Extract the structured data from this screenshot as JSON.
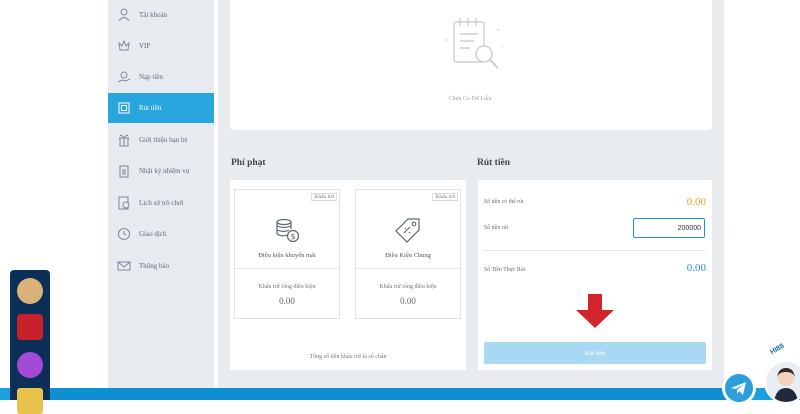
{
  "sidebar": {
    "items": [
      {
        "label": "Tài khoản",
        "icon": "user-icon"
      },
      {
        "label": "VIP",
        "icon": "vip-icon"
      },
      {
        "label": "Nạp tiền",
        "icon": "deposit-icon"
      },
      {
        "label": "Rút tiền",
        "icon": "withdraw-icon",
        "active": true
      },
      {
        "label": "Giới thiệu bạn bè",
        "icon": "gift-icon"
      },
      {
        "label": "Nhật ký nhiệm vụ",
        "icon": "clipboard-icon"
      },
      {
        "label": "Lịch sử trò chơi",
        "icon": "history-icon"
      },
      {
        "label": "Giao dịch",
        "icon": "transaction-icon"
      },
      {
        "label": "Thông báo",
        "icon": "mail-icon"
      }
    ]
  },
  "empty_state": {
    "text": "Chưa Có Dữ Liệu",
    "icon": "document-search-icon"
  },
  "penalty": {
    "title": "Phí phạt",
    "cards": [
      {
        "tag": "Khấu trừ",
        "name": "Điều kiện khuyến mãi",
        "sub": "Khấu trừ tổng điều kiện",
        "value": "0.00",
        "icon": "coins-icon"
      },
      {
        "tag": "Khấu trừ",
        "name": "Điều Kiện Chung",
        "sub": "Khấu trừ tổng điều kiện",
        "value": "0.00",
        "icon": "price-tag-icon"
      }
    ],
    "total_text": "Tổng số tiền khấu trừ là số chẵn"
  },
  "withdraw": {
    "title": "Rút tiền",
    "available_label": "Số tiền có thể rút",
    "available_value": "0.00",
    "amount_label": "Số tiền rút",
    "amount_value": "200000",
    "real_label": "Số Tiền Thực Rút",
    "real_value": "0.00",
    "button_label": "Rút tiền"
  },
  "brand_tag": "HI88",
  "colors": {
    "accent": "#2aa6df",
    "available": "#e8a21a",
    "real": "#2a8ad8",
    "button_disabled": "#a9d9f2",
    "arrow": "#d3242c"
  }
}
